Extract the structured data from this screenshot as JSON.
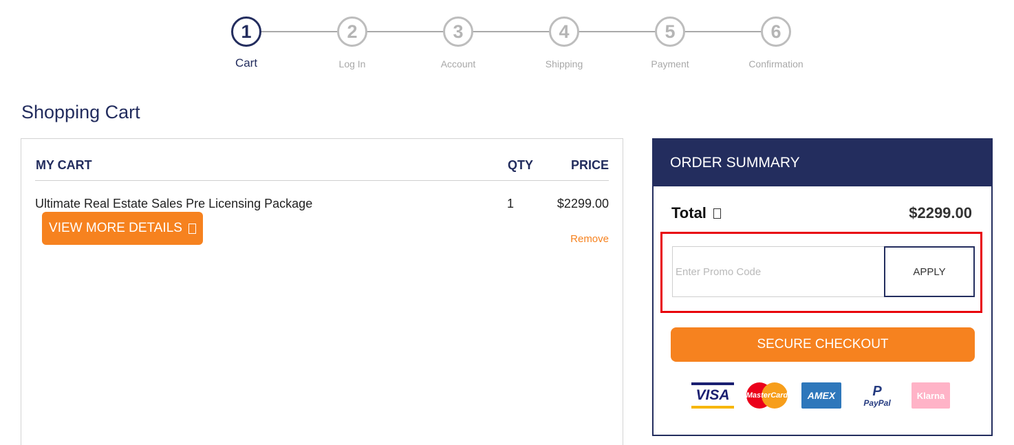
{
  "stepper": {
    "steps": [
      {
        "number": "1",
        "label": "Cart"
      },
      {
        "number": "2",
        "label": "Log In"
      },
      {
        "number": "3",
        "label": "Account"
      },
      {
        "number": "4",
        "label": "Shipping"
      },
      {
        "number": "5",
        "label": "Payment"
      },
      {
        "number": "6",
        "label": "Confirmation"
      }
    ],
    "active_step": 1
  },
  "page_title": "Shopping Cart",
  "cart": {
    "headers": {
      "my_cart": "MY CART",
      "qty": "QTY",
      "price": "PRICE"
    },
    "items": [
      {
        "name": "Ultimate Real Estate Sales Pre Licensing Package",
        "qty": "1",
        "price": "$2299.00",
        "details_label": "VIEW MORE DETAILS",
        "remove_label": "Remove"
      }
    ]
  },
  "summary": {
    "title": "ORDER SUMMARY",
    "total_label": "Total",
    "total_value": "$2299.00",
    "promo_placeholder": "Enter Promo Code",
    "apply_label": "APPLY",
    "checkout_label": "SECURE CHECKOUT",
    "payment_methods": [
      {
        "icon": "visa-icon",
        "text": "VISA"
      },
      {
        "icon": "mastercard-icon",
        "text": "MasterCard"
      },
      {
        "icon": "amex-icon",
        "text": "AMEX"
      },
      {
        "icon": "paypal-icon",
        "text": "PayPal"
      },
      {
        "icon": "klarna-icon",
        "text": "Klarna"
      }
    ]
  },
  "colors": {
    "navy": "#232d5e",
    "orange": "#f6821f",
    "highlight_red": "#e8000b"
  }
}
